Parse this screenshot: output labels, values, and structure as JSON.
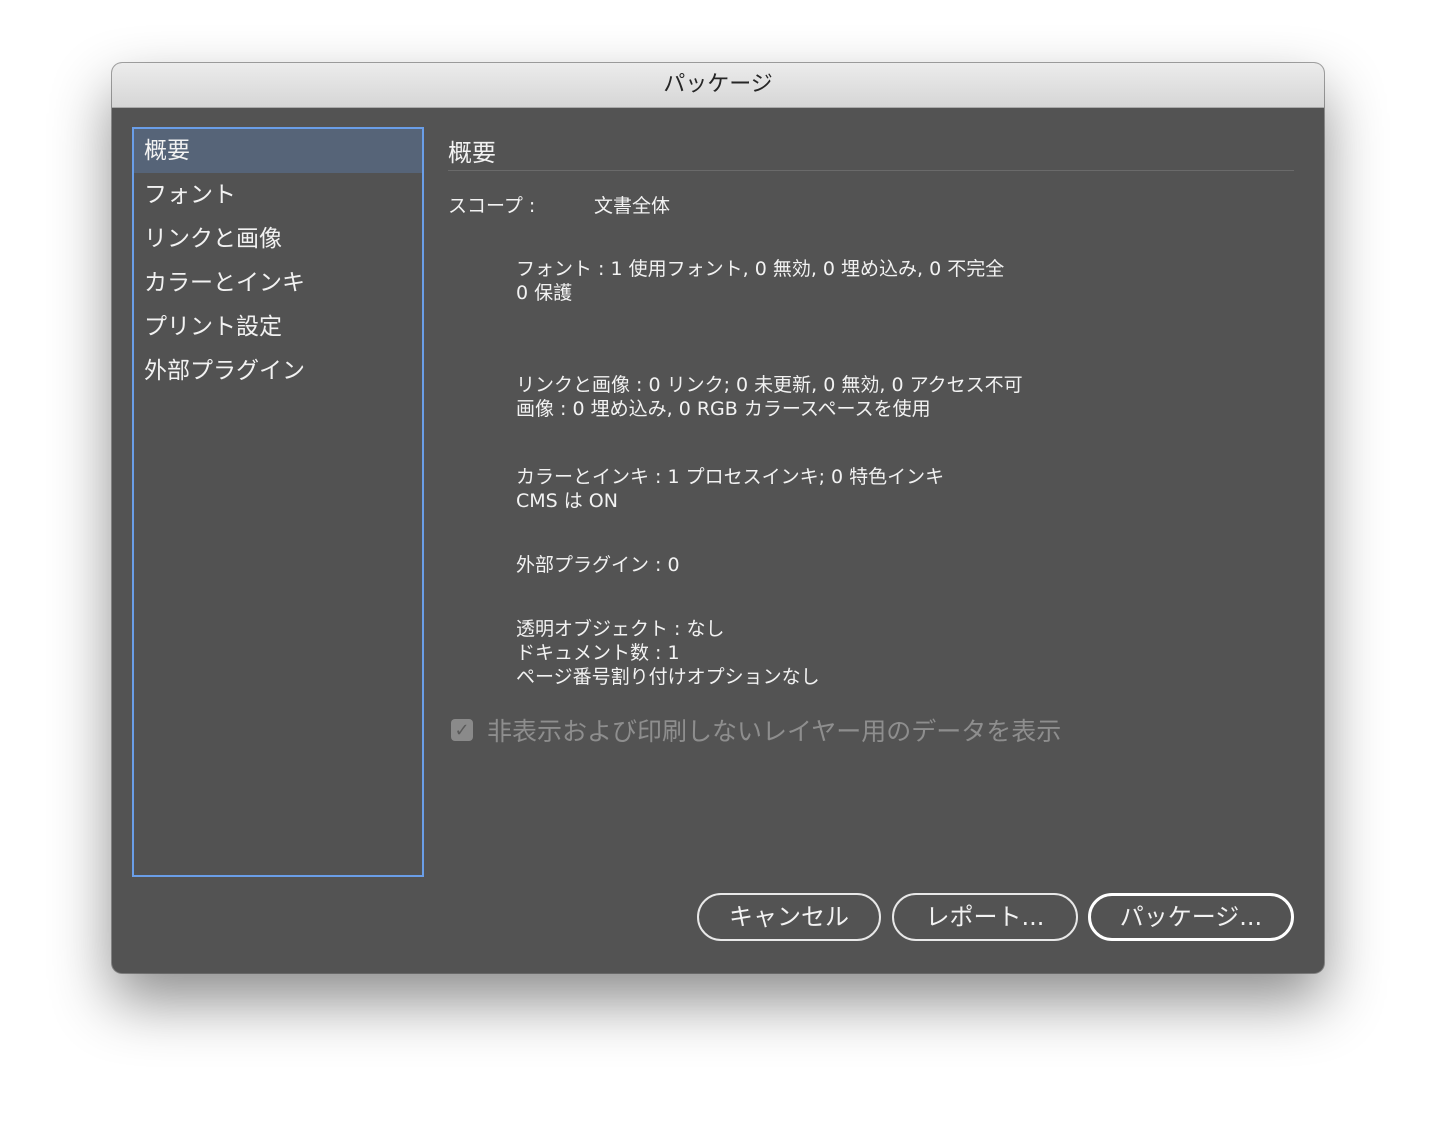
{
  "window": {
    "title": "パッケージ"
  },
  "sidebar": {
    "items": [
      {
        "label": "概要",
        "selected": true
      },
      {
        "label": "フォント",
        "selected": false
      },
      {
        "label": "リンクと画像",
        "selected": false
      },
      {
        "label": "カラーとインキ",
        "selected": false
      },
      {
        "label": "プリント設定",
        "selected": false
      },
      {
        "label": "外部プラグイン",
        "selected": false
      }
    ]
  },
  "main": {
    "title": "概要",
    "scope_label": "スコープ :",
    "scope_value": "文書全体",
    "fonts": {
      "line1": "フォント : 1 使用フォント, 0 無効, 0 埋め込み, 0 不完全",
      "line2": "0 保護"
    },
    "links": {
      "line1": "リンクと画像 : 0 リンク; 0 未更新, 0 無効, 0 アクセス不可",
      "line2": "画像 : 0 埋め込み, 0 RGB カラースペースを使用"
    },
    "colors": {
      "line1": "カラーとインキ : 1 プロセスインキ; 0 特色インキ",
      "line2": "CMS は ON"
    },
    "plugins": {
      "line1": "外部プラグイン : 0"
    },
    "misc": {
      "line1": "透明オブジェクト : なし",
      "line2": "ドキュメント数 : 1",
      "line3": "ページ番号割り付けオプションなし"
    },
    "checkbox": {
      "label": "非表示および印刷しないレイヤー用のデータを表示",
      "checked": true,
      "disabled": true
    }
  },
  "buttons": {
    "cancel": "キャンセル",
    "report": "レポート...",
    "package": "パッケージ..."
  },
  "colors": {
    "panel_bg": "#535353",
    "selection_bg": "#566478",
    "focus_ring": "#6a9ee8"
  }
}
